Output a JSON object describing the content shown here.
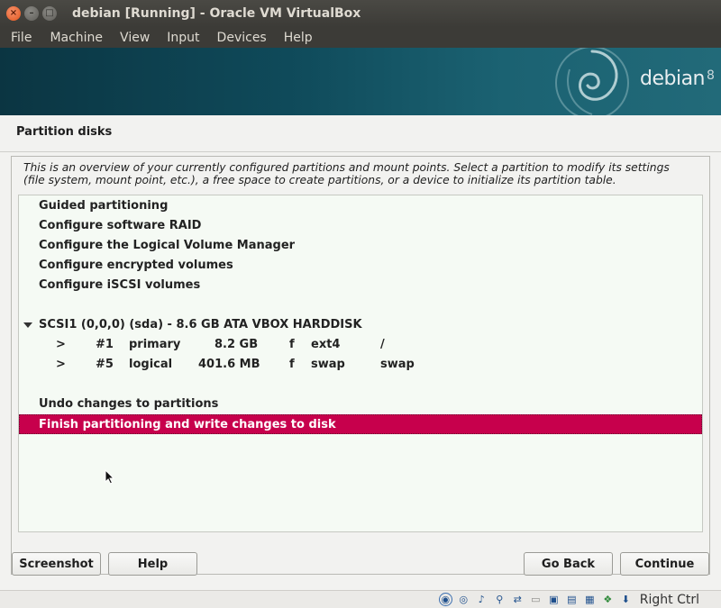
{
  "window": {
    "title": "debian [Running] - Oracle VM VirtualBox"
  },
  "menu": [
    "File",
    "Machine",
    "View",
    "Input",
    "Devices",
    "Help"
  ],
  "banner": {
    "logo_text": "debian",
    "logo_version": "8"
  },
  "installer": {
    "heading": "Partition disks",
    "description_line1": "This is an overview of your currently configured partitions and mount points. Select a partition to modify its settings",
    "description_line2": "(file system, mount point, etc.), a free space to create partitions, or a device to initialize its partition table.",
    "items": {
      "guided": "Guided partitioning",
      "raid": "Configure software RAID",
      "lvm": "Configure the Logical Volume Manager",
      "encrypted": "Configure encrypted volumes",
      "iscsi": "Configure iSCSI volumes",
      "disk": "SCSI1 (0,0,0) (sda) - 8.6 GB ATA VBOX HARDDISK",
      "undo": "Undo changes to partitions",
      "finish": "Finish partitioning and write changes to disk"
    },
    "partitions": [
      {
        "arrow": ">",
        "num": "#1",
        "type": "primary",
        "size": "8.2 GB",
        "flag": "f",
        "fs": "ext4",
        "mount": "/"
      },
      {
        "arrow": ">",
        "num": "#5",
        "type": "logical",
        "size": "401.6 MB",
        "flag": "f",
        "fs": "swap",
        "mount": "swap"
      }
    ],
    "buttons": {
      "screenshot": "Screenshot",
      "help": "Help",
      "go_back": "Go Back",
      "continue": "Continue"
    }
  },
  "statusbar": {
    "host_key": "Right Ctrl",
    "icons": [
      "hard-disk-icon",
      "optical-disk-icon",
      "audio-icon",
      "network-icon",
      "usb-icon",
      "shared-folder-icon",
      "display-icon",
      "video-capture-icon",
      "cpu-icon",
      "mouse-integration-icon",
      "keyboard-icon"
    ]
  },
  "colors": {
    "selection": "#c7004c",
    "banner": "#0f4a5a",
    "titlebar": "#3c3b37"
  }
}
